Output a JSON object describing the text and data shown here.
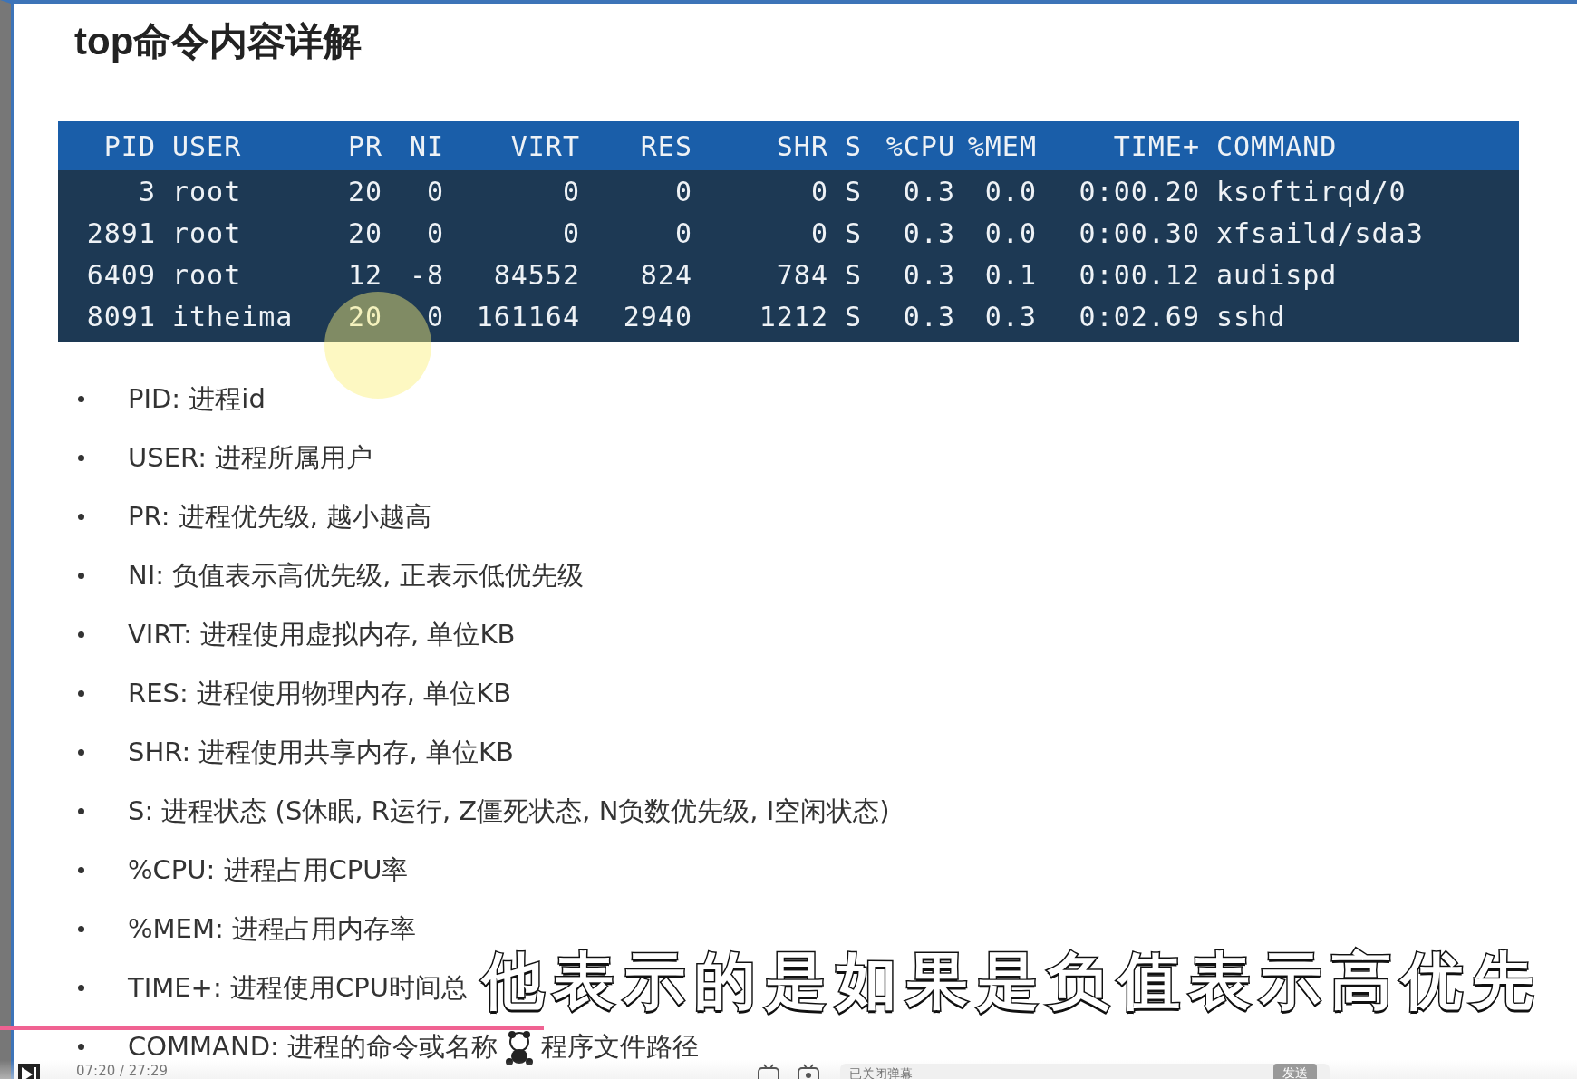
{
  "slide": {
    "title": "top命令内容详解",
    "table": {
      "columns": [
        "PID",
        "USER",
        "PR",
        "NI",
        "VIRT",
        "RES",
        "SHR",
        "S",
        "%CPU",
        "%MEM",
        "TIME+",
        "COMMAND"
      ],
      "rows": [
        [
          "3",
          "root",
          "20",
          "0",
          "0",
          "0",
          "0",
          "S",
          "0.3",
          "0.0",
          "0:00.20",
          "ksoftirqd/0"
        ],
        [
          "2891",
          "root",
          "20",
          "0",
          "0",
          "0",
          "0",
          "S",
          "0.3",
          "0.0",
          "0:00.30",
          "xfsaild/sda3"
        ],
        [
          "6409",
          "root",
          "12",
          "-8",
          "84552",
          "824",
          "784",
          "S",
          "0.3",
          "0.1",
          "0:00.12",
          "audispd"
        ],
        [
          "8091",
          "itheima",
          "20",
          "0",
          "161164",
          "2940",
          "1212",
          "S",
          "0.3",
          "0.3",
          "0:02.69",
          "sshd"
        ]
      ]
    },
    "bullets": [
      {
        "text": "PID: 进程id"
      },
      {
        "text": "USER: 进程所属用户"
      },
      {
        "text": "PR: 进程优先级, 越小越高"
      },
      {
        "text": "NI: 负值表示高优先级, 正表示低优先级"
      },
      {
        "text": "VIRT: 进程使用虚拟内存, 单位KB"
      },
      {
        "text": "RES: 进程使用物理内存, 单位KB"
      },
      {
        "text": "SHR: 进程使用共享内存, 单位KB"
      },
      {
        "text": "S: 进程状态 (S休眠, R运行, Z僵死状态, N负数优先级, I空闲状态)"
      },
      {
        "text": "%CPU: 进程占用CPU率"
      },
      {
        "text": "%MEM: 进程占用内存率"
      },
      {
        "text": "TIME+: 进程使用CPU时间总"
      },
      {
        "text": "COMMAND: 进程的命令或名称",
        "text_after": "程序文件路径"
      }
    ]
  },
  "subtitle": "他表示的是如果是负值表示高优先",
  "player": {
    "progress": {
      "level": 0.345
    },
    "time": "07:20 / 27:29",
    "danmaku_placeholder": "已关闭弹幕",
    "send_button": "发送"
  }
}
